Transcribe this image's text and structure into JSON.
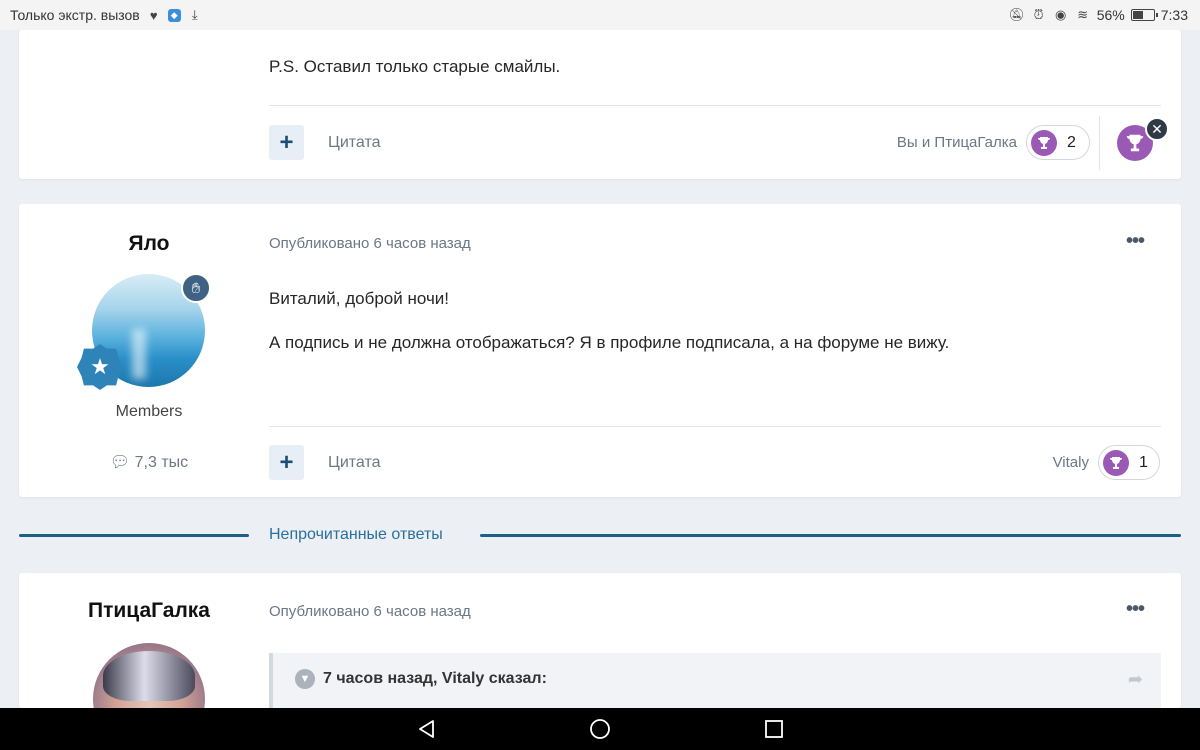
{
  "status_bar": {
    "carrier": "Только экстр. вызов",
    "battery": "56%",
    "battery_level": 0.56,
    "time": "7:33"
  },
  "posts": [
    {
      "body": [
        "P.S. Оставил только старые смайлы."
      ],
      "quote_label": "Цитата",
      "reactions_names": "Вы и ПтицаГалка",
      "reaction_count": "2"
    },
    {
      "author": "Яло",
      "date": "Опубликовано 6 часов назад",
      "group": "Members",
      "post_count": "7,3 тыс",
      "body": [
        "Виталий, доброй ночи!",
        "А подпись и не должна отображаться? Я в профиле подписала, а на форуме не вижу."
      ],
      "quote_label": "Цитата",
      "reactions_names": "Vitaly",
      "reaction_count": "1"
    },
    {
      "author": "ПтицаГалка",
      "date": "Опубликовано 6 часов назад",
      "quote_header": "7 часов назад, Vitaly сказал:"
    }
  ],
  "divider": {
    "label": "Непрочитанные ответы"
  },
  "colors": {
    "accent": "#1d5f86",
    "reaction": "#9a59b5",
    "background": "#eceff4"
  }
}
